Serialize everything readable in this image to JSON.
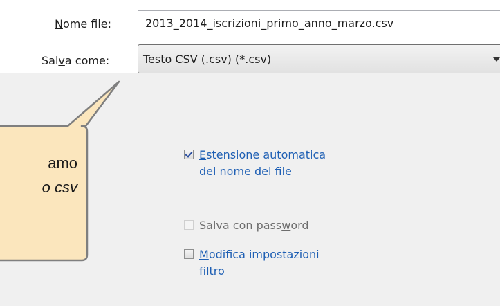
{
  "file_name": {
    "label_accel": "N",
    "label_rest": "ome file:",
    "value": "2013_2014_iscrizioni_primo_anno_marzo.csv"
  },
  "save_as": {
    "label_pre": "Sal",
    "label_accel": "v",
    "label_post": "a come:",
    "value": "Testo CSV (.csv) (*.csv)"
  },
  "callout": {
    "line1": "amo",
    "line2": "o csv"
  },
  "options": {
    "auto_ext_accel": "E",
    "auto_ext_line1_rest": "stensione automatica",
    "auto_ext_line2": "del nome del file",
    "auto_ext_checked": true,
    "password_pre": "Salva con pass",
    "password_accel": "w",
    "password_post": "ord",
    "password_enabled": false,
    "filter_accel": "M",
    "filter_line1_rest": "odifica impostazioni",
    "filter_line2": "filtro",
    "filter_checked": false
  },
  "colors": {
    "callout_fill": "#fbe6bd",
    "callout_border": "#7f7f7f",
    "link_text": "#1e5fb4",
    "panel_bg": "#f0f0f0"
  }
}
